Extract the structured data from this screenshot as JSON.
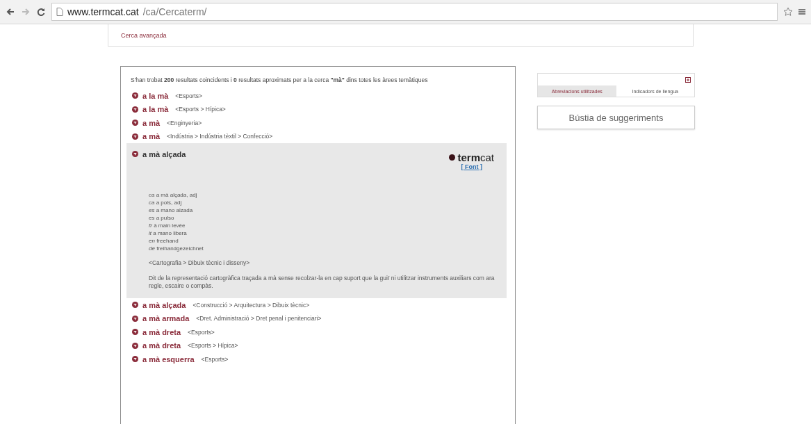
{
  "browser": {
    "url_host": "www.termcat.cat",
    "url_path": "/ca/Cercaterm/"
  },
  "top_card": {
    "link": "Cerca avançada"
  },
  "summary": "S'han trobat **200** resultats coincidents i **0** resultats aproximats per a la cerca **\"mà\"** dins totes les àrees temàtiques",
  "results": [
    {
      "term": "a la mà",
      "area": "<Esports>",
      "expanded": false
    },
    {
      "term": "a la mà",
      "area": "<Esports > Hípica>",
      "expanded": false
    },
    {
      "term": "a mà",
      "area": "<Enginyeria>",
      "expanded": false
    },
    {
      "term": "a mà",
      "area": "<Indústria > Indústria tèxtil > Confecció>",
      "expanded": false
    },
    {
      "term": "a mà alçada",
      "expanded": true,
      "logo": "**term**cat",
      "source_link": "[ Font ]",
      "equivalents": [
        {
          "lang": "ca",
          "text": "a mà alçada, adj"
        },
        {
          "lang": "ca",
          "text": "a pols, adj"
        },
        {
          "lang": "es",
          "text": "a mano alzada"
        },
        {
          "lang": "es",
          "text": "a pulso"
        },
        {
          "lang": "fr",
          "text": "à main levée"
        },
        {
          "lang": "it",
          "text": "a mano libera"
        },
        {
          "lang": "en",
          "text": "freehand"
        },
        {
          "lang": "de",
          "text": "freihandgezeichnet"
        }
      ],
      "detail_area": "<Cartografia > Dibuix tècnic i disseny>",
      "definition": "Dit de la representació cartogràfica traçada a mà sense recolzar-la en cap suport que la guiï ni utilitzar instruments auxiliars com ara regle, escaire o compàs."
    },
    {
      "term": "a mà alçada",
      "area": "<Construcció > Arquitectura > Dibuix tècnic>",
      "expanded": false
    },
    {
      "term": "a mà armada",
      "area": "<Dret. Administració > Dret penal i penitenciari>",
      "expanded": false
    },
    {
      "term": "a mà dreta",
      "area": "<Esports>",
      "expanded": false
    },
    {
      "term": "a mà dreta",
      "area": "<Esports > Hípica>",
      "expanded": false
    },
    {
      "term": "a mà esquerra",
      "area": "<Esports>",
      "expanded": false
    }
  ],
  "sidebar": {
    "tabs": [
      {
        "label": "Abreviacions utilitzades",
        "selected": true
      },
      {
        "label": "Indicadors de llengua",
        "selected": false
      }
    ],
    "suggestions_button": "Bústia de suggeriments"
  }
}
